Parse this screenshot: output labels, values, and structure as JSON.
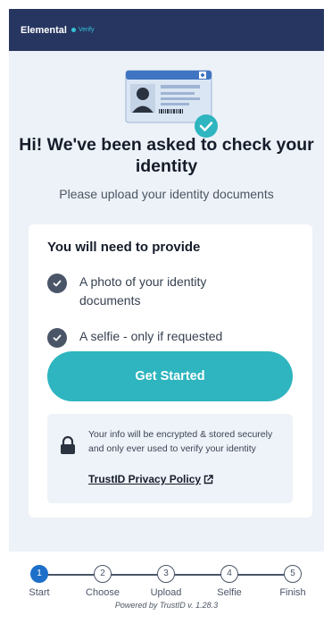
{
  "topbar": {
    "brand": "Elemental",
    "verify": "Verify"
  },
  "hero": {
    "icon": "id-card-check-illustration"
  },
  "heading": {
    "title": "Hi! We've been asked to check your identity",
    "subtitle": "Please upload your identity documents"
  },
  "card": {
    "title": "You will need to provide",
    "requirements": [
      {
        "label": "A photo of your identity documents"
      },
      {
        "label": "A selfie - only if requested"
      }
    ],
    "cta": "Get Started",
    "info_text": "Your info will be encrypted & stored securely and only ever used to verify your identity",
    "privacy_link": "TrustID Privacy Policy"
  },
  "steps": [
    {
      "num": "1",
      "label": "Start",
      "active": true
    },
    {
      "num": "2",
      "label": "Choose",
      "active": false
    },
    {
      "num": "3",
      "label": "Upload",
      "active": false
    },
    {
      "num": "4",
      "label": "Selfie",
      "active": false
    },
    {
      "num": "5",
      "label": "Finish",
      "active": false
    }
  ],
  "powered_by": "Powered by TrustID v. 1.28.3",
  "colors": {
    "header": "#273661",
    "accent": "#2eb5bf",
    "active_step": "#1d6fc9",
    "check": "#4a5568"
  }
}
